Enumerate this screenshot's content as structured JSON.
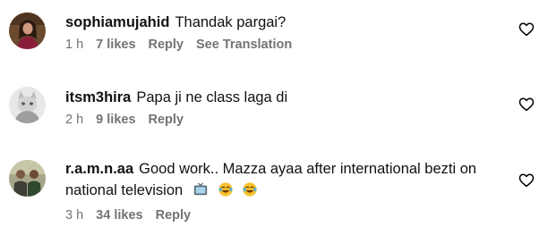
{
  "comments": [
    {
      "username": "sophiamujahid",
      "text": "Thandak pargai?",
      "time": "1 h",
      "likes": "7 likes",
      "reply": "Reply",
      "translate": "See Translation",
      "avatar_icon": "profile-photo-woman"
    },
    {
      "username": "itsm3hira",
      "text": "Papa ji ne class laga di",
      "time": "2 h",
      "likes": "9 likes",
      "reply": "Reply",
      "avatar_icon": "profile-photo-cat"
    },
    {
      "username": "r.a.m.n.aa",
      "text_line1": "Good work.. Mazza ayaa after international bezti on",
      "text_line2": "national television",
      "emojis": [
        "television-emoji",
        "laughing-crying-emoji",
        "laughing-crying-emoji"
      ],
      "time": "3 h",
      "likes": "34 likes",
      "reply": "Reply",
      "avatar_icon": "profile-photo-two-men"
    }
  ],
  "heart_icon": "heart-outline-icon"
}
